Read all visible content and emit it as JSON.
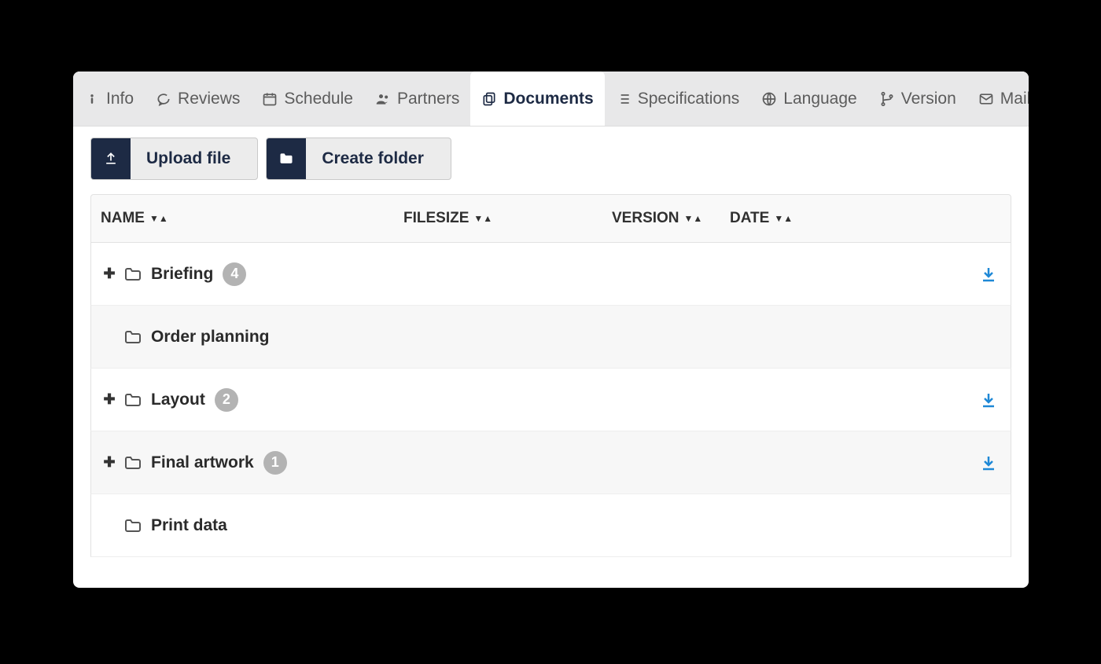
{
  "tabs": [
    {
      "id": "info",
      "label": "Info",
      "icon": "info"
    },
    {
      "id": "reviews",
      "label": "Reviews",
      "icon": "chat"
    },
    {
      "id": "schedule",
      "label": "Schedule",
      "icon": "calendar"
    },
    {
      "id": "partners",
      "label": "Partners",
      "icon": "users"
    },
    {
      "id": "documents",
      "label": "Documents",
      "icon": "copy",
      "active": true
    },
    {
      "id": "specifications",
      "label": "Specifications",
      "icon": "list"
    },
    {
      "id": "language",
      "label": "Language",
      "icon": "globe"
    },
    {
      "id": "version",
      "label": "Version",
      "icon": "branch"
    },
    {
      "id": "mails",
      "label": "Mails",
      "icon": "mail"
    }
  ],
  "toolbar": {
    "upload_label": "Upload file",
    "create_folder_label": "Create folder"
  },
  "columns": {
    "name": "NAME",
    "filesize": "FILESIZE",
    "version": "VERSION",
    "date": "DATE"
  },
  "rows": [
    {
      "name": "Briefing",
      "count": "4",
      "expandable": true,
      "downloadable": true
    },
    {
      "name": "Order planning",
      "expandable": false,
      "downloadable": false
    },
    {
      "name": "Layout",
      "count": "2",
      "expandable": true,
      "downloadable": true
    },
    {
      "name": "Final artwork",
      "count": "1",
      "expandable": true,
      "downloadable": true
    },
    {
      "name": "Print data",
      "expandable": false,
      "downloadable": false
    }
  ]
}
